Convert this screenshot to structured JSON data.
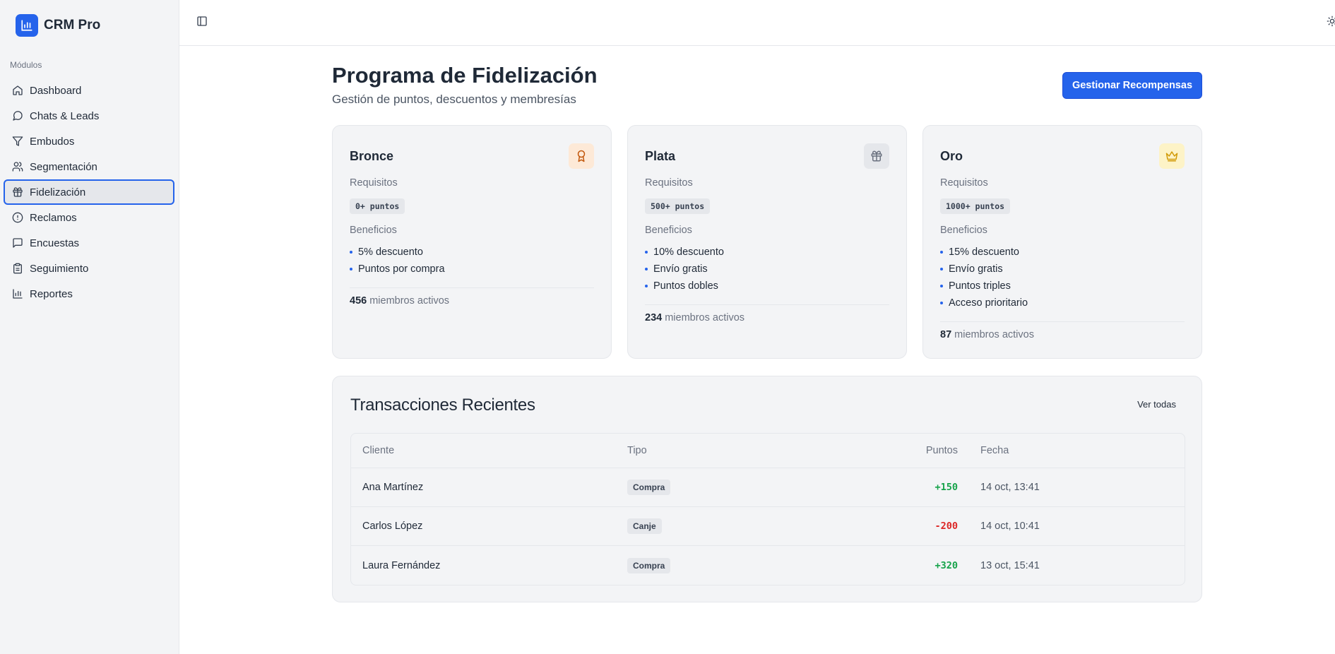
{
  "brand": {
    "name": "CRM Pro"
  },
  "sidebar": {
    "section_label": "Módulos",
    "items": [
      {
        "label": "Dashboard",
        "icon": "home-icon"
      },
      {
        "label": "Chats & Leads",
        "icon": "chat-bubble-icon"
      },
      {
        "label": "Embudos",
        "icon": "filter-icon"
      },
      {
        "label": "Segmentación",
        "icon": "users-icon"
      },
      {
        "label": "Fidelización",
        "icon": "gift-icon",
        "active": true
      },
      {
        "label": "Reclamos",
        "icon": "alert-circle-icon"
      },
      {
        "label": "Encuestas",
        "icon": "message-square-icon"
      },
      {
        "label": "Seguimiento",
        "icon": "clipboard-icon"
      },
      {
        "label": "Reportes",
        "icon": "bar-chart-icon"
      }
    ]
  },
  "header": {
    "title": "Programa de Fidelización",
    "subtitle": "Gestión de puntos, descuentos y membresías",
    "action_label": "Gestionar Recompensas"
  },
  "tiers": [
    {
      "name": "Bronce",
      "icon": "award-icon",
      "requirements_label": "Requisitos",
      "requirement": "0+ puntos",
      "benefits_label": "Beneficios",
      "benefits": [
        "5% descuento",
        "Puntos por compra"
      ],
      "members_count": "456",
      "members_label": "miembros activos"
    },
    {
      "name": "Plata",
      "icon": "gift-icon",
      "requirements_label": "Requisitos",
      "requirement": "500+ puntos",
      "benefits_label": "Beneficios",
      "benefits": [
        "10% descuento",
        "Envío gratis",
        "Puntos dobles"
      ],
      "members_count": "234",
      "members_label": "miembros activos"
    },
    {
      "name": "Oro",
      "icon": "crown-icon",
      "requirements_label": "Requisitos",
      "requirement": "1000+ puntos",
      "benefits_label": "Beneficios",
      "benefits": [
        "15% descuento",
        "Envío gratis",
        "Puntos triples",
        "Acceso prioritario"
      ],
      "members_count": "87",
      "members_label": "miembros activos"
    }
  ],
  "transactions": {
    "title": "Transacciones Recientes",
    "view_all_label": "Ver todas",
    "columns": [
      "Cliente",
      "Tipo",
      "Puntos",
      "Fecha"
    ],
    "rows": [
      {
        "client": "Ana Martínez",
        "type": "Compra",
        "points": "+150",
        "date": "14 oct, 13:41"
      },
      {
        "client": "Carlos López",
        "type": "Canje",
        "points": "-200",
        "date": "14 oct, 10:41"
      },
      {
        "client": "Laura Fernández",
        "type": "Compra",
        "points": "+320",
        "date": "13 oct, 15:41"
      }
    ]
  },
  "colors": {
    "accent": "#2563eb",
    "positive": "#16a34a",
    "negative": "#dc2626",
    "bronze_bg": "#fde9d7",
    "bronze_fg": "#c2570c",
    "silver_bg": "#e5e7eb",
    "silver_fg": "#6b7280",
    "gold_bg": "#fdf3c7",
    "gold_fg": "#d19a06"
  }
}
